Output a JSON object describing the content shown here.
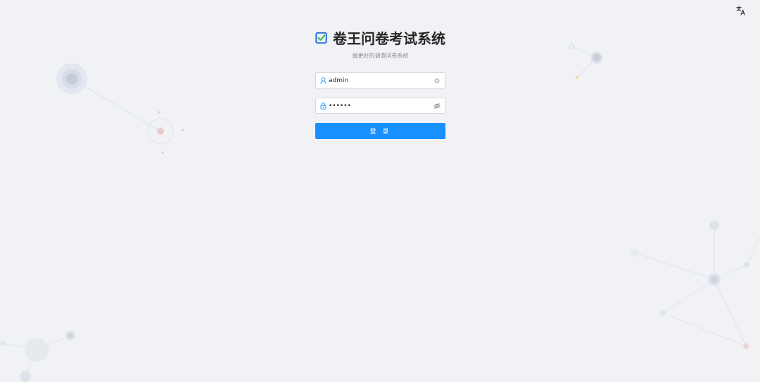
{
  "app": {
    "title": "卷王问卷考试系统",
    "subtitle": "做更好的调查问卷系统"
  },
  "login_form": {
    "username_value": "admin",
    "password_value": "••••••",
    "submit_label": "登 录"
  },
  "icons": {
    "language": "translate-icon",
    "logo": "checkbox-logo-icon",
    "username_prefix": "user-icon",
    "username_suffix": "clear-circle-icon",
    "password_prefix": "lock-icon",
    "password_suffix": "eye-invisible-icon"
  },
  "colors": {
    "primary": "#1890ff",
    "logo_blue": "#1f6fe5",
    "logo_check": "#3ab54a",
    "background": "#f0f2f5",
    "title": "#262626",
    "subtitle": "#8c8c8c"
  }
}
